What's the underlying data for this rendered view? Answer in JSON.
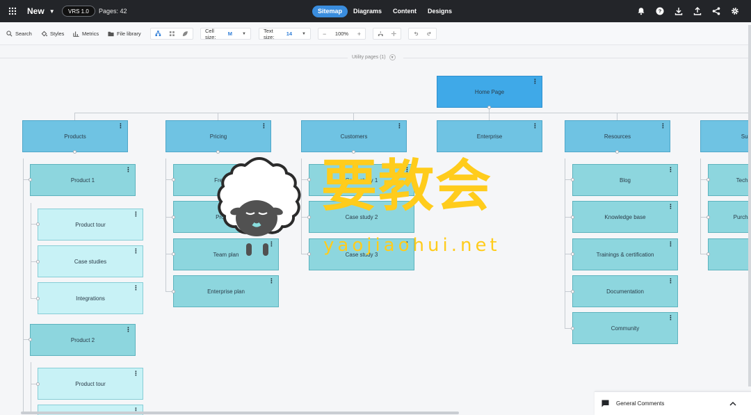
{
  "topbar": {
    "project_title": "New",
    "version_badge": "VRS 1.0",
    "pages_count": "Pages: 42",
    "nav": [
      "Sitemap",
      "Diagrams",
      "Content",
      "Designs"
    ],
    "active_tab": "Sitemap",
    "right_icons": [
      "bell-icon",
      "help-icon",
      "download-icon",
      "upload-icon",
      "share-icon",
      "settings-icon"
    ]
  },
  "toolbar": {
    "search": "Search",
    "styles": "Styles",
    "metrics": "Metrics",
    "file_library": "File library",
    "cell_size_label": "Cell size:",
    "cell_size_value": "M",
    "text_size_label": "Text size:",
    "text_size_value": "14",
    "zoom": "100%",
    "zoom_out": "−",
    "zoom_in": "+"
  },
  "utility_pages": "Utility pages (1)",
  "sitemap": {
    "home": "Home Page",
    "level1": [
      "Products",
      "Pricing",
      "Customers",
      "Enterprise",
      "Resources",
      "Sup"
    ],
    "products_children": [
      "Product 1",
      "Product 2"
    ],
    "product1_children": [
      "Product tour",
      "Case studies",
      "Integrations"
    ],
    "product2_children": [
      "Product tour",
      ""
    ],
    "pricing_children": [
      "Free plan",
      "Pro plan",
      "Team plan",
      "Enterprise plan"
    ],
    "customers_children": [
      "Case study 1",
      "Case study 2",
      "Case study 3"
    ],
    "resources_children": [
      "Blog",
      "Knowledge base",
      "Trainings & certification",
      "Documentation",
      "Community"
    ],
    "support_children": [
      "Techn",
      "Purcha",
      ""
    ]
  },
  "watermark": {
    "cn": "要教会",
    "en": "yaojiaohui.net"
  },
  "comments": {
    "label": "General Comments"
  },
  "colors": {
    "topbar": "#232529",
    "accent": "#3a8dde",
    "home_node": "#3fa9e8",
    "level1_node": "#6fc3e3",
    "level2_node": "#8dd6de",
    "level3_node": "#c8f2f6",
    "watermark": "#ffcc1c"
  }
}
